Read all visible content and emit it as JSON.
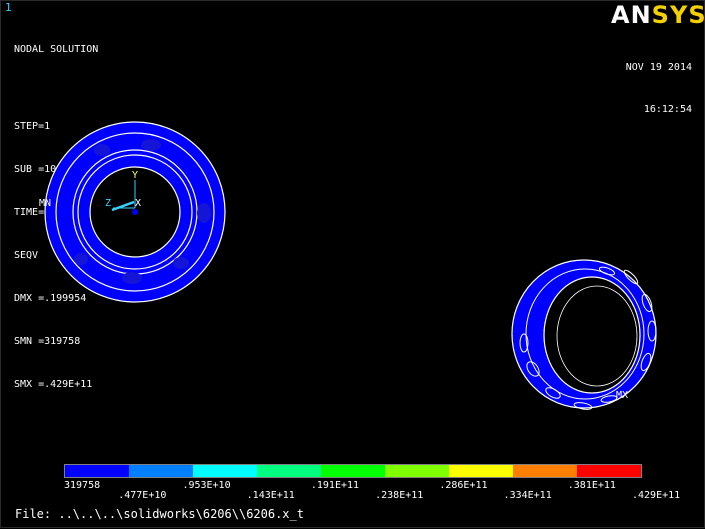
{
  "window_number": "1",
  "result_title": "NODAL SOLUTION",
  "info_lines": [
    "STEP=1",
    "SUB =101",
    "TIME=.05",
    "SEQV     (AVG)",
    "DMX =.199954",
    "SMN =319758",
    "SMX =.429E+11"
  ],
  "brand": {
    "part1": "AN",
    "part2": "SYS"
  },
  "date": "NOV 19 2014",
  "time": "16:12:54",
  "markers": {
    "min": "MN",
    "max": "MX"
  },
  "axis": {
    "x": "X",
    "y": "Y",
    "z": "Z"
  },
  "legend": {
    "colors": [
      "#0000ff",
      "#0080ff",
      "#00ffff",
      "#00ff80",
      "#00ff00",
      "#80ff00",
      "#ffff00",
      "#ff8000",
      "#ff0000"
    ],
    "labels": [
      "319758",
      ".477E+10",
      ".953E+10",
      ".143E+11",
      ".191E+11",
      ".238E+11",
      ".286E+11",
      ".334E+11",
      ".381E+11",
      ".429E+11"
    ]
  },
  "file_path": "File: ..\\..\\..\\solidworks\\6206\\\\6206.x_t"
}
